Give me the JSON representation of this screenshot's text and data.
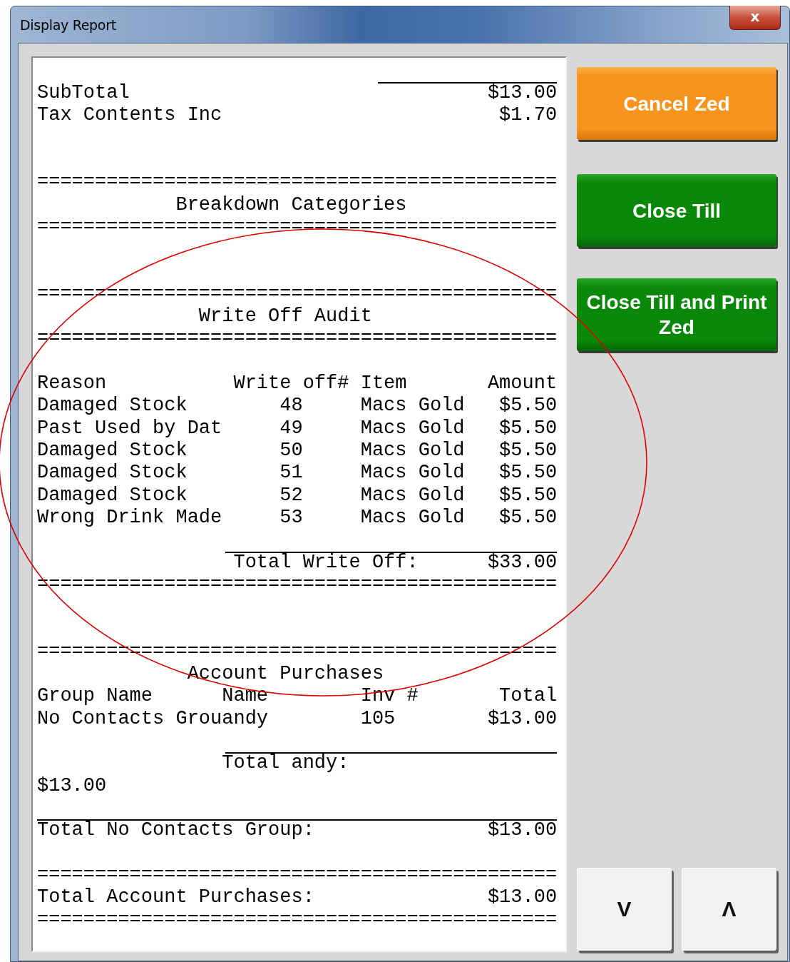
{
  "window": {
    "title": "Display Report",
    "close_label": "x"
  },
  "report": {
    "lines": [
      {
        "kind": "text_short_rule",
        "text": "SubTotal                               $13.00"
      },
      {
        "kind": "text",
        "text": "Tax Contents Inc                        $1.70"
      },
      {
        "kind": "blank"
      },
      {
        "kind": "blank"
      },
      {
        "kind": "text",
        "text": "============================================="
      },
      {
        "kind": "text",
        "text": "            Breakdown Categories"
      },
      {
        "kind": "text",
        "text": "============================================="
      },
      {
        "kind": "blank"
      },
      {
        "kind": "blank"
      },
      {
        "kind": "text",
        "text": "============================================="
      },
      {
        "kind": "text",
        "text": "              Write Off Audit"
      },
      {
        "kind": "text",
        "text": "============================================="
      },
      {
        "kind": "blank"
      },
      {
        "kind": "text",
        "text": "Reason           Write off# Item       Amount"
      },
      {
        "kind": "text",
        "text": "Damaged Stock        48     Macs Gold   $5.50"
      },
      {
        "kind": "text",
        "text": "Past Used by Dat     49     Macs Gold   $5.50"
      },
      {
        "kind": "text",
        "text": "Damaged Stock        50     Macs Gold   $5.50"
      },
      {
        "kind": "text",
        "text": "Damaged Stock        51     Macs Gold   $5.50"
      },
      {
        "kind": "text",
        "text": "Damaged Stock        52     Macs Gold   $5.50"
      },
      {
        "kind": "text",
        "text": "Wrong Drink Made     53     Macs Gold   $5.50"
      },
      {
        "kind": "blank"
      },
      {
        "kind": "text_medium_rule",
        "text": "                 Total Write Off:      $33.00"
      },
      {
        "kind": "text",
        "text": "============================================="
      },
      {
        "kind": "blank"
      },
      {
        "kind": "blank"
      },
      {
        "kind": "text",
        "text": "============================================="
      },
      {
        "kind": "text",
        "text": "             Account Purchases"
      },
      {
        "kind": "text",
        "text": "Group Name      Name        Inv #       Total"
      },
      {
        "kind": "text",
        "text": "No Contacts Grouandy        105        $13.00"
      },
      {
        "kind": "blank"
      },
      {
        "kind": "text_medium_rule",
        "text": "                Total andy:"
      },
      {
        "kind": "text",
        "text": "$13.00"
      },
      {
        "kind": "blank"
      },
      {
        "kind": "text_full_rule",
        "text": "Total No Contacts Group:               $13.00"
      },
      {
        "kind": "blank"
      },
      {
        "kind": "text",
        "text": "============================================="
      },
      {
        "kind": "text",
        "text": "Total Account Purchases:               $13.00"
      },
      {
        "kind": "text",
        "text": "============================================="
      }
    ]
  },
  "actions": [
    {
      "label": "Cancel Zed",
      "kind": "orange"
    },
    {
      "label": "Close Till",
      "kind": "green"
    },
    {
      "label": "Close Till and Print Zed",
      "kind": "green"
    }
  ],
  "scroll_buttons": [
    {
      "label": "V"
    },
    {
      "label": "Λ"
    }
  ],
  "annotation": {
    "kind": "ellipse"
  }
}
